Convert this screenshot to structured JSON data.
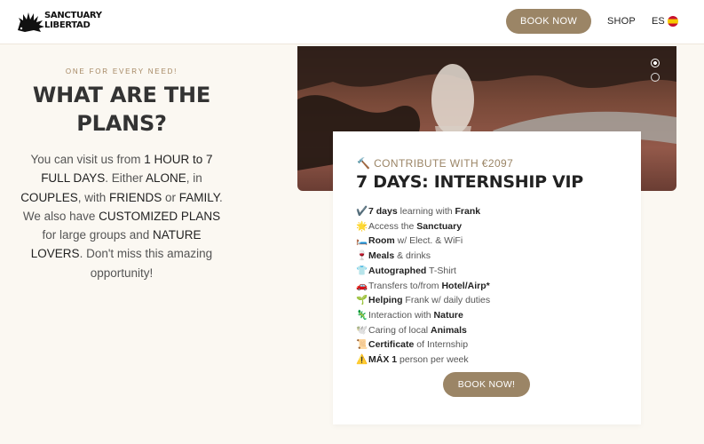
{
  "header": {
    "logo_line1": "SANCTUARY",
    "logo_line2": "LIBERTAD",
    "book_now": "BOOK NOW",
    "shop": "SHOP",
    "lang": "ES"
  },
  "intro": {
    "eyebrow": "ONE FOR EVERY NEED!",
    "title": "WHAT ARE THE PLANS?",
    "desc": [
      {
        "t": "You can visit us from ",
        "b": false
      },
      {
        "t": "1 HOUR to 7 FULL DAYS",
        "b": true
      },
      {
        "t": ". Either ",
        "b": false
      },
      {
        "t": "ALONE",
        "b": true
      },
      {
        "t": ", in ",
        "b": false
      },
      {
        "t": "COUPLES",
        "b": true
      },
      {
        "t": ", with ",
        "b": false
      },
      {
        "t": "FRIENDS",
        "b": true
      },
      {
        "t": " or ",
        "b": false
      },
      {
        "t": "FAMILY",
        "b": true
      },
      {
        "t": ". We also have ",
        "b": false
      },
      {
        "t": "CUSTOMIZED PLANS",
        "b": true
      },
      {
        "t": " for large groups and ",
        "b": false
      },
      {
        "t": "NATURE LOVERS",
        "b": true
      },
      {
        "t": ". Don't miss this amazing opportunity!",
        "b": false
      }
    ]
  },
  "carousel": {
    "slides": 2,
    "active": 0
  },
  "plan": {
    "price_icon": "🔨",
    "price": "CONTRIBUTE WITH €2097",
    "title": "7 DAYS: INTERNSHIP VIP",
    "features": [
      {
        "icon": "✔️",
        "parts": [
          {
            "t": "7 days",
            "b": true
          },
          {
            "t": " learning with ",
            "b": false
          },
          {
            "t": "Frank",
            "b": true
          }
        ]
      },
      {
        "icon": "🌟",
        "parts": [
          {
            "t": "Access the ",
            "b": false
          },
          {
            "t": "Sanctuary",
            "b": true
          }
        ]
      },
      {
        "icon": "🛏️",
        "parts": [
          {
            "t": "Room",
            "b": true
          },
          {
            "t": " w/ Elect. & WiFi",
            "b": false
          }
        ]
      },
      {
        "icon": "🍷",
        "parts": [
          {
            "t": "Meals",
            "b": true
          },
          {
            "t": " & drinks",
            "b": false
          }
        ]
      },
      {
        "icon": "👕",
        "parts": [
          {
            "t": "Autographed",
            "b": true
          },
          {
            "t": " T-Shirt",
            "b": false
          }
        ]
      },
      {
        "icon": "🚗",
        "parts": [
          {
            "t": "Transfers to/from ",
            "b": false
          },
          {
            "t": "Hotel/Airp*",
            "b": true
          }
        ]
      },
      {
        "icon": "🌱",
        "parts": [
          {
            "t": "Helping",
            "b": true
          },
          {
            "t": " Frank w/ daily duties",
            "b": false
          }
        ]
      },
      {
        "icon": "🦎",
        "parts": [
          {
            "t": "Interaction with ",
            "b": false
          },
          {
            "t": "Nature",
            "b": true
          }
        ]
      },
      {
        "icon": "🕊️",
        "parts": [
          {
            "t": "Caring of local ",
            "b": false
          },
          {
            "t": "Animals",
            "b": true
          }
        ]
      },
      {
        "icon": "📜",
        "parts": [
          {
            "t": "Certificate",
            "b": true
          },
          {
            "t": " of Internship",
            "b": false
          }
        ]
      },
      {
        "icon": "⚠️",
        "parts": [
          {
            "t": "MÁX 1",
            "b": true
          },
          {
            "t": " person per week",
            "b": false
          }
        ]
      }
    ],
    "button": "BOOK NOW!"
  },
  "colors": {
    "accent": "#9b8566",
    "eyebrow": "#a58762",
    "background": "#fbf8f2"
  },
  "icons": {
    "logo": "porcupine-logo-icon",
    "flag": "spain-flag-icon"
  }
}
